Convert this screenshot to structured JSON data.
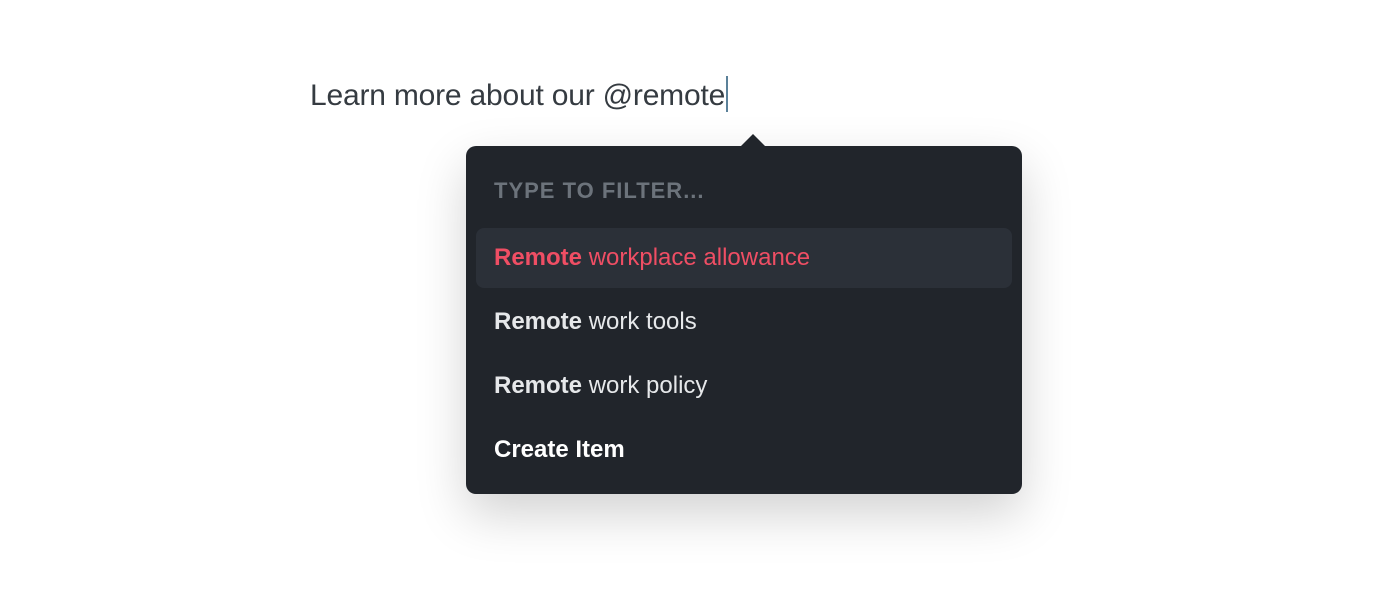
{
  "composer": {
    "text": "Learn more about our @remote"
  },
  "popover": {
    "filter_label": "TYPE TO FILTER...",
    "suggestions": [
      {
        "match": "Remote",
        "rest": " workplace allowance",
        "selected": true
      },
      {
        "match": "Remote",
        "rest": " work tools",
        "selected": false
      },
      {
        "match": "Remote",
        "rest": " work policy",
        "selected": false
      }
    ],
    "create_label": "Create Item"
  },
  "colors": {
    "accent": "#ef4e64",
    "popover_bg": "#21252b",
    "selected_bg": "#2b3038",
    "muted": "#6c737b",
    "caret": "#5b8199"
  }
}
